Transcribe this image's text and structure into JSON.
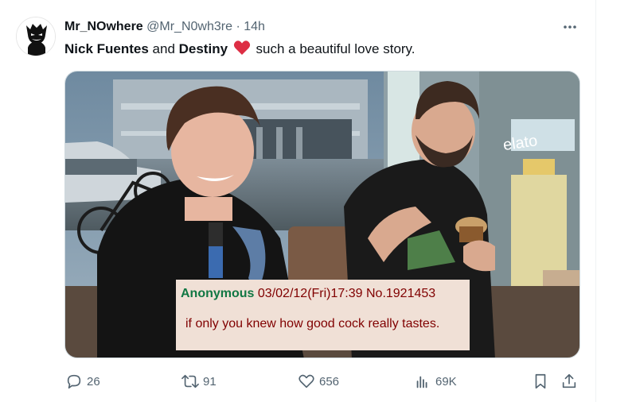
{
  "author": {
    "display_name": "Mr_NOwhere",
    "handle": "@Mr_N0wh3re",
    "separator": "·",
    "time": "14h"
  },
  "tweet": {
    "part1": "Nick Fuentes",
    "part2": " and ",
    "part3": "Destiny",
    "part4": " such a beautiful love story.",
    "heart_color": "#e0245e"
  },
  "media": {
    "post_name": "Anonymous",
    "post_meta": "03/02/12(Fri)17:39 No.1921453",
    "post_text": "if only you knew how good cock really tastes.",
    "storefront_sign": "elato"
  },
  "actions": {
    "replies": "26",
    "reposts": "91",
    "likes": "656",
    "views": "69K"
  },
  "colors": {
    "text_secondary": "#536471",
    "caption_bg": "#f0e0d6",
    "caption_name": "#117743",
    "caption_text": "#800000"
  }
}
